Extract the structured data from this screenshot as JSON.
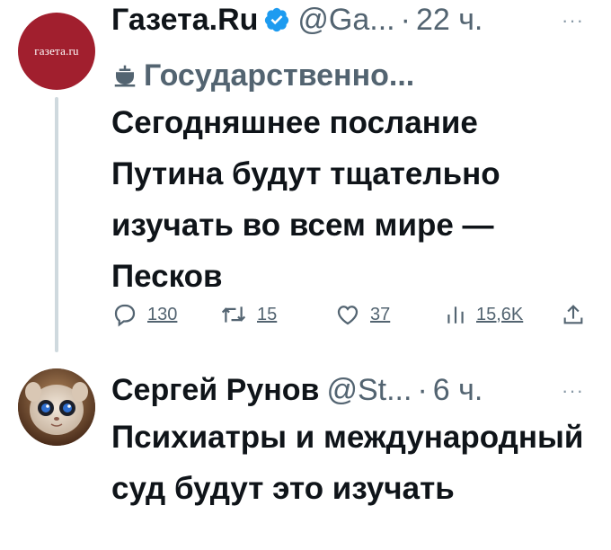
{
  "tweets": [
    {
      "avatar_text": "газета.ru",
      "name": "Газета.Ru",
      "handle": "@Ga...",
      "separator": "·",
      "time": "22 ч.",
      "more": "···",
      "label": "Государственно...",
      "text": "Сегодняшнее послание Путина будут тщательно изучать во всем мире — Песков",
      "stats": {
        "replies": "130",
        "retweets": "15",
        "likes": "37",
        "views": "15,6K"
      }
    },
    {
      "name": "Сергей Рунов",
      "handle": "@St...",
      "separator": "·",
      "time": "6 ч.",
      "more": "···",
      "text": "Психиатры и международный суд будут это изучать"
    }
  ],
  "colors": {
    "verified": "#1d9bf0",
    "gazeta_red": "#a11f2e",
    "secondary_text": "#536471",
    "thread_line": "#cfd9de"
  }
}
